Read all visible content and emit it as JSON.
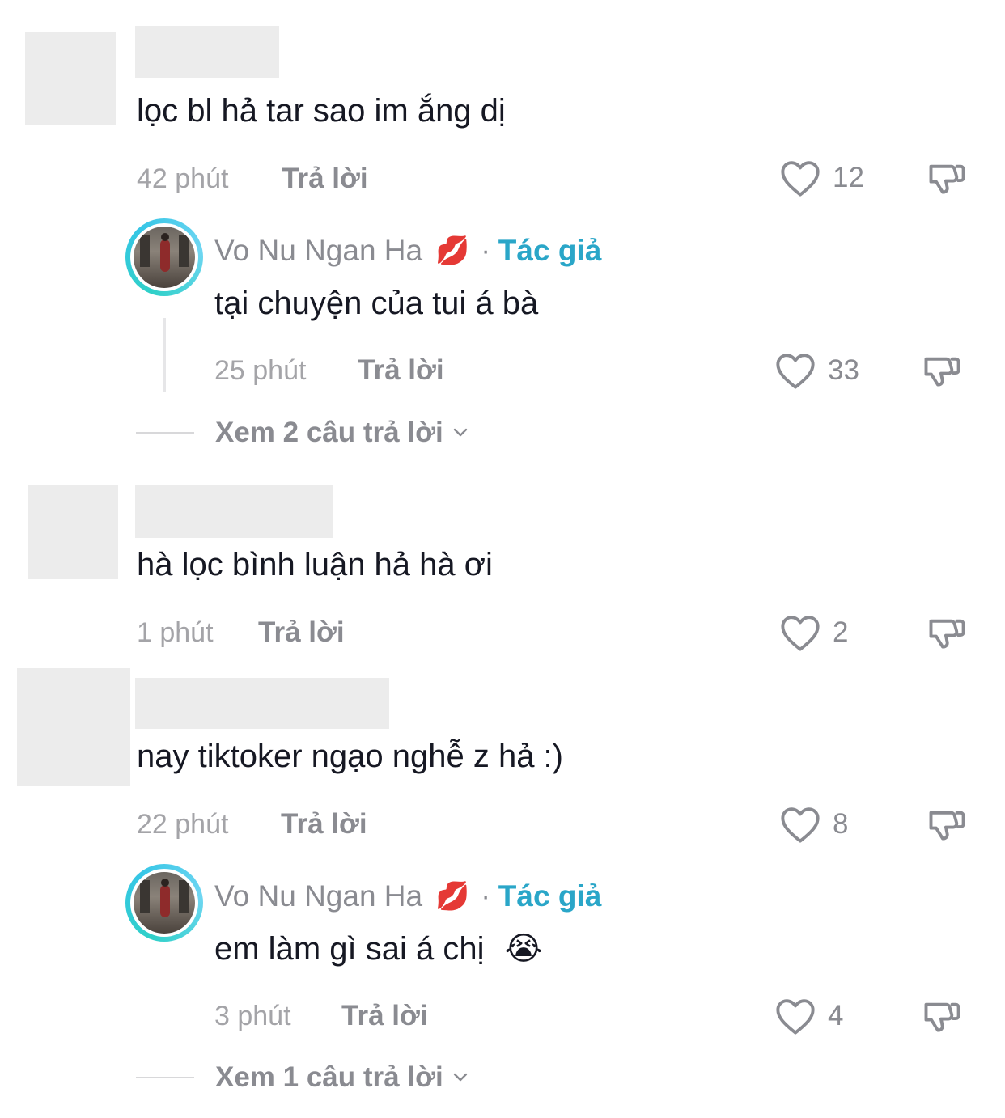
{
  "comments": [
    {
      "text": "lọc bl hả tar sao im ắng dị",
      "time": "42 phút",
      "reply_label": "Trả lời",
      "likes": "12",
      "replies": [
        {
          "author": "Vo Nu Ngan Ha",
          "author_emoji": "💋",
          "separator": "·",
          "badge": "Tác giả",
          "text": "tại chuyện của tui á bà",
          "time": "25 phút",
          "reply_label": "Trả lời",
          "likes": "33"
        }
      ],
      "view_more": "Xem 2 câu trả lời"
    },
    {
      "text": "hà lọc bình luận hả hà ơi",
      "time": "1 phút",
      "reply_label": "Trả lời",
      "likes": "2"
    },
    {
      "text": "nay tiktoker ngạo nghễ z hả :)",
      "time": "22 phút",
      "reply_label": "Trả lời",
      "likes": "8",
      "replies": [
        {
          "author": "Vo Nu Ngan Ha",
          "author_emoji": "💋",
          "separator": "·",
          "badge": "Tác giả",
          "text": "em làm gì sai á chị",
          "text_emoji": "😭",
          "time": "3 phút",
          "reply_label": "Trả lời",
          "likes": "4"
        }
      ],
      "view_more": "Xem 1 câu trả lời"
    }
  ],
  "icons": {
    "like": "heart-outline-icon",
    "dislike": "thumbs-down-outline-icon",
    "expand": "chevron-down-icon"
  },
  "colors": {
    "text": "#161823",
    "muted": "#8a8b91",
    "time": "#a4a4a8",
    "author_badge": "#2aa6c8",
    "avatar_ring": "#2fd0c8"
  }
}
